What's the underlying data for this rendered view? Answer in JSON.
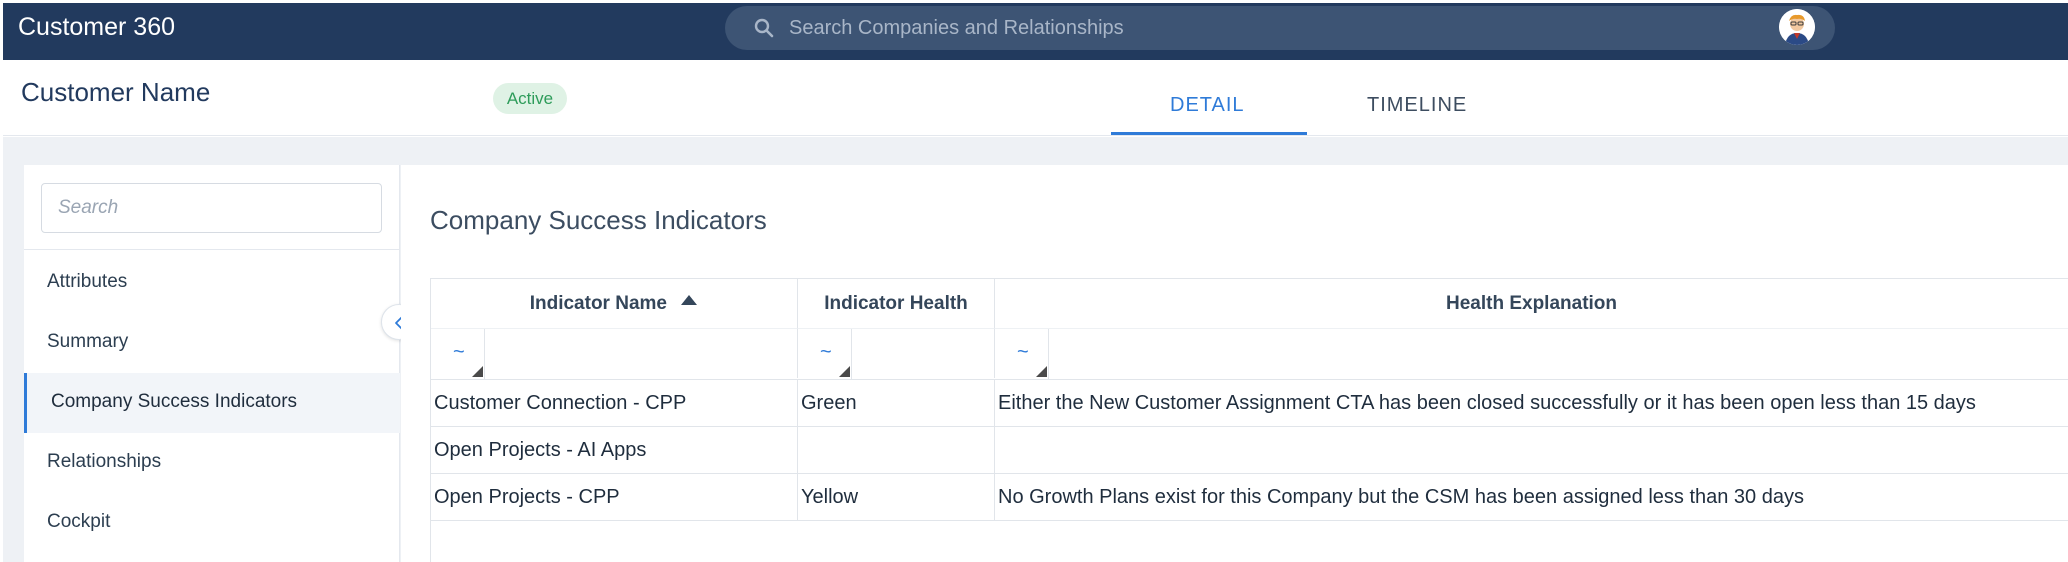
{
  "topbar": {
    "app_title": "Customer 360",
    "search_placeholder": "Search Companies and Relationships",
    "search_icon": "search-icon",
    "avatar_icon": "user-avatar"
  },
  "header": {
    "customer_name": "Customer Name",
    "status_badge": "Active",
    "tabs": [
      {
        "label": "DETAIL",
        "active": true
      },
      {
        "label": "TIMELINE",
        "active": false
      }
    ],
    "accent_color": "#2f7bd8"
  },
  "sidebar": {
    "search_placeholder": "Search",
    "items": [
      {
        "label": "Attributes",
        "active": false
      },
      {
        "label": "Summary",
        "active": false
      },
      {
        "label": "Company Success Indicators",
        "active": true
      },
      {
        "label": "Relationships",
        "active": false
      },
      {
        "label": "Cockpit",
        "active": false
      }
    ],
    "collapse_icon": "chevron-left-icon"
  },
  "main": {
    "section_title": "Company Success Indicators",
    "table": {
      "columns": [
        {
          "label": "Indicator Name",
          "sort": "ascending"
        },
        {
          "label": "Indicator Health"
        },
        {
          "label": "Health Explanation"
        }
      ],
      "filter_symbol": "~",
      "rows": [
        {
          "name": "Customer Connection - CPP",
          "health": "Green",
          "explanation": "Either the New Customer Assignment CTA has been closed successfully or it has been open less than 15 days"
        },
        {
          "name": "Open Projects - AI Apps",
          "health": "",
          "explanation": ""
        },
        {
          "name": "Open Projects - CPP",
          "health": "Yellow",
          "explanation": "No Growth Plans exist for this Company but the CSM has been assigned less than 30 days"
        }
      ]
    }
  }
}
